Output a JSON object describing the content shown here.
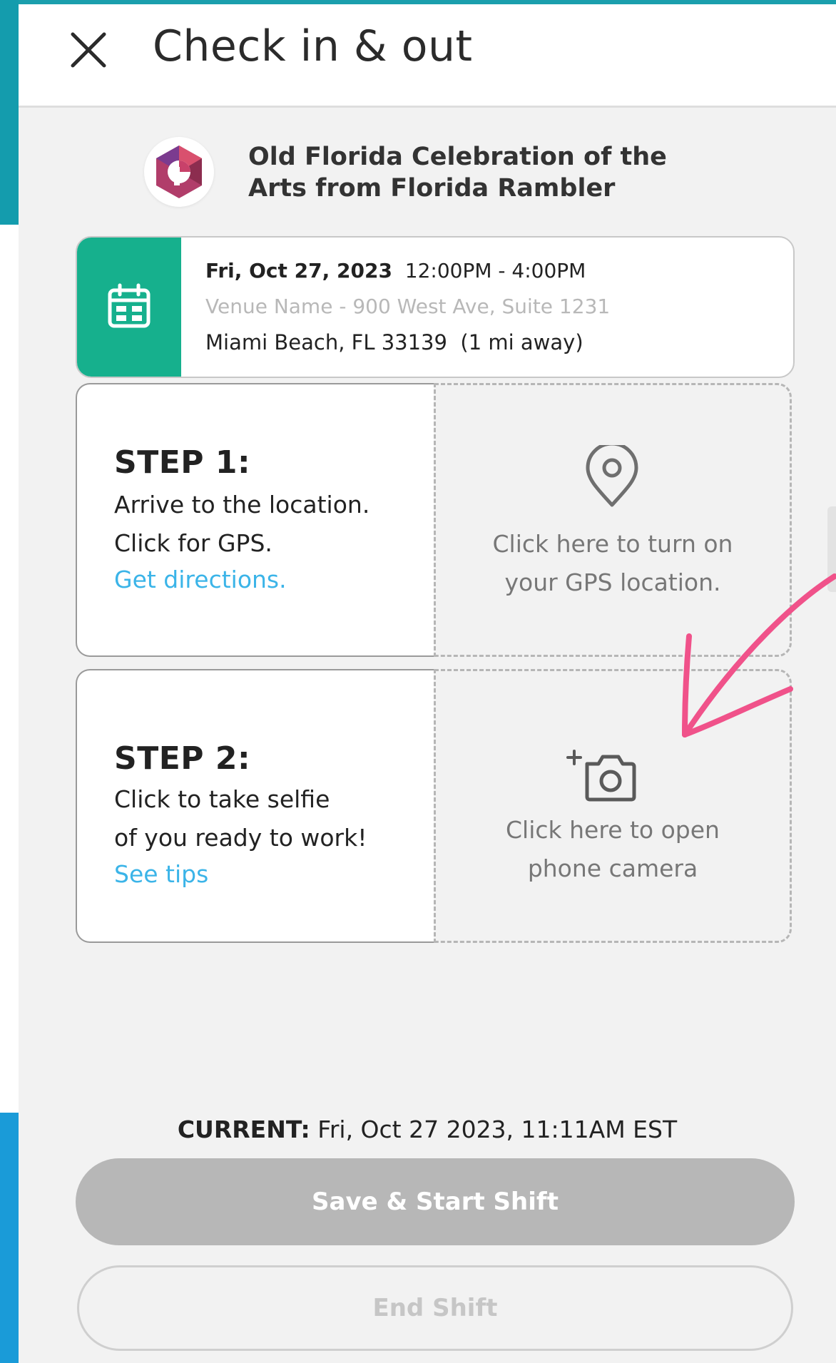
{
  "header": {
    "title": "Check in & out"
  },
  "event": {
    "title_line1": "Old Florida Celebration of the",
    "title_line2": "Arts from Florida Rambler"
  },
  "schedule": {
    "date": "Fri, Oct 27, 2023",
    "time": "12:00PM - 4:00PM",
    "venue": "Venue Name - 900 West Ave, Suite 1231",
    "city": "Miami Beach, FL 33139",
    "distance": "(1 mi away)"
  },
  "steps": [
    {
      "title": "STEP 1:",
      "line1": "Arrive to the location.",
      "line2": "Click for GPS.",
      "link": "Get directions.",
      "action_line1": "Click here to turn on",
      "action_line2": "your GPS location."
    },
    {
      "title": "STEP 2:",
      "line1": "Click to take selfie",
      "line2": "of you ready to work!",
      "link": "See tips",
      "action_line1": "Click here to open",
      "action_line2": "phone camera"
    }
  ],
  "footer": {
    "current_label": "CURRENT:",
    "current_value": "Fri, Oct 27 2023, 11:11AM EST",
    "save_button": "Save & Start Shift",
    "end_button": "End Shift"
  },
  "colors": {
    "accent_green": "#16b08d",
    "link_blue": "#3bb4e8",
    "arrow_pink": "#f0528a",
    "button_disabled": "#b7b7b7"
  },
  "icons": {
    "close": "close-icon",
    "calendar": "calendar-icon",
    "location": "map-pin-icon",
    "camera": "add-camera-icon",
    "logo": "event-logo"
  }
}
